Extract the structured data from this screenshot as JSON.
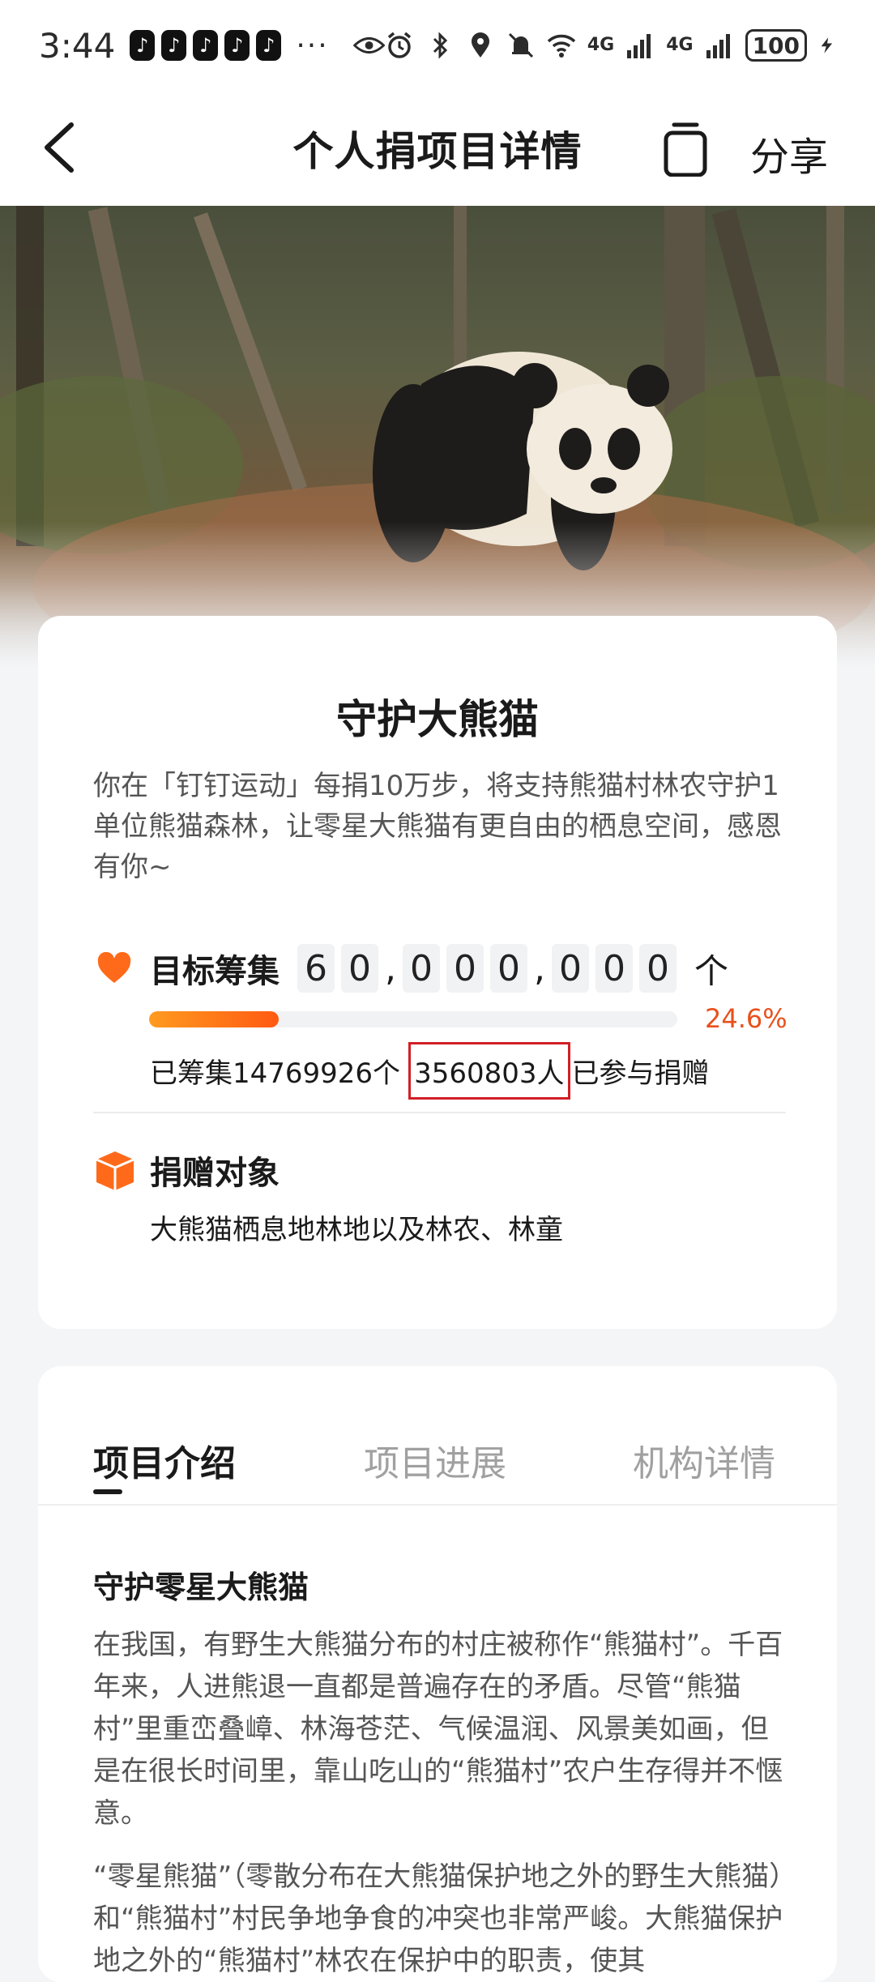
{
  "status_bar": {
    "time": "3:44",
    "app_icons": [
      "tiktok-icon",
      "tiktok-icon",
      "tiktok-icon",
      "tiktok-icon",
      "tiktok-icon"
    ],
    "more": "···",
    "net1": "4G",
    "net2": "4G",
    "battery": "100"
  },
  "nav": {
    "title": "个人捐项目详情",
    "share_label": "分享"
  },
  "project": {
    "title": "守护大熊猫",
    "description": "你在「钉钉运动」每捐10万步，将支持熊猫村林农守护1单位熊猫森林，让零星大熊猫有更自由的栖息空间，感恩有你~",
    "goal_label": "目标筹集",
    "goal_digits": [
      "6",
      "0",
      ",",
      "0",
      "0",
      "0",
      ",",
      "0",
      "0",
      "0"
    ],
    "goal_unit": "个",
    "progress_percent": 24.6,
    "progress_text": "24.6%",
    "raised_text": "已筹集14769926个",
    "participants": "3560803人",
    "participants_suffix": "已参与捐赠",
    "target_label": "捐赠对象",
    "target_desc": "大熊猫栖息地林地以及林农、林童"
  },
  "tabs": [
    {
      "label": "项目介绍",
      "active": true
    },
    {
      "label": "项目进展",
      "active": false
    },
    {
      "label": "机构详情",
      "active": false
    }
  ],
  "intro": {
    "heading": "守护零星大熊猫",
    "paragraph1": "在我国，有野生大熊猫分布的村庄被称作“熊猫村”。千百年来，人进熊退一直都是普遍存在的矛盾。尽管“熊猫村”里重峦叠嶂、林海苍茫、气候温润、风景美如画，但是在很长时间里，靠山吃山的“熊猫村”农户生存得并不惬意。",
    "paragraph2": "“零星熊猫”（零散分布在大熊猫保护地之外的野生大熊猫）和“熊猫村”村民争地争食的冲突也非常严峻。大熊猫保护地之外的“熊猫村”林农在保护中的职责，使其"
  },
  "colors": {
    "accent": "#ff5a12",
    "highlight_box": "#d21f26"
  }
}
